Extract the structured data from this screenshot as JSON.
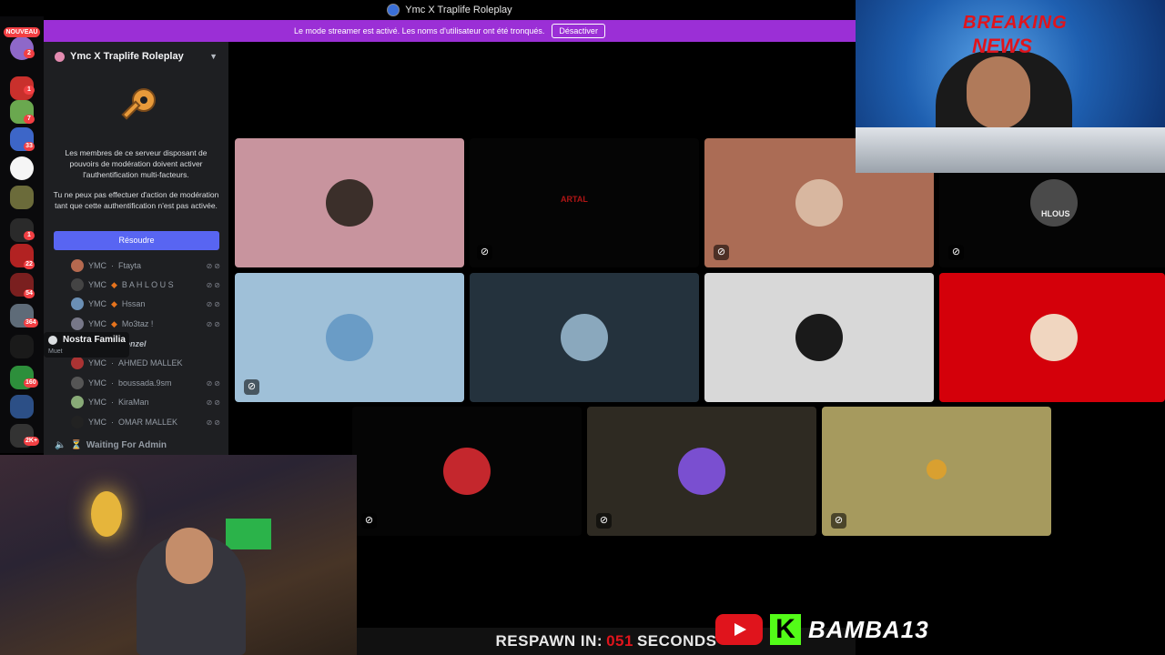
{
  "window": {
    "title": "Ymc X Traplife Roleplay"
  },
  "banner": {
    "message": "Le mode streamer est activé. Les noms d'utilisateur ont été tronqués.",
    "button": "Désactiver"
  },
  "rail": {
    "new_label": "NOUVEAU",
    "badges": [
      "2",
      "1",
      "7",
      "33",
      "1",
      "22",
      "54",
      "364",
      "160",
      "2K+"
    ]
  },
  "sidebar": {
    "server_name": "Ymc X Traplife Roleplay",
    "mfa_text_1": "Les membres de ce serveur disposant de pouvoirs de modération doivent activer l'authentification multi-facteurs.",
    "mfa_text_2": "Tu ne peux pas effectuer d'action de modération tant que cette authentification n'est pas activée.",
    "resolve_button": "Résoudre",
    "members": [
      {
        "prefix": "YMC",
        "sep": "·",
        "name": "Ftayta",
        "color": "#b5694f"
      },
      {
        "prefix": "YMC",
        "sep": "◆",
        "name": "B A H L O U S",
        "color": "#444"
      },
      {
        "prefix": "YMC",
        "sep": "◆",
        "name": "Hssan",
        "color": "#6b8fb5"
      },
      {
        "prefix": "YMC",
        "sep": "◆",
        "name": "Mo3taz !",
        "color": "#778"
      },
      {
        "prefix": "",
        "sep": "",
        "name": "enzel",
        "color": "#333"
      },
      {
        "prefix": "YMC",
        "sep": "·",
        "name": "AHMED MALLEK",
        "color": "#a33"
      },
      {
        "prefix": "YMC",
        "sep": "·",
        "name": "boussada.9sm",
        "color": "#555"
      },
      {
        "prefix": "YMC",
        "sep": "·",
        "name": "KiraMan",
        "color": "#8a7"
      },
      {
        "prefix": "YMC",
        "sep": "·",
        "name": "OMAR MALLEK",
        "color": "#222"
      }
    ],
    "channel": "Waiting For Admin",
    "tooltip_title": "Nostra Familia",
    "tooltip_sub": "Muet"
  },
  "tiles": [
    {
      "bg": "#c8949e",
      "avatar": "#3b2f2a"
    },
    {
      "bg": "#050505",
      "avatar": "",
      "label": "ARTAL"
    },
    {
      "bg": "#ab6c55",
      "avatar": "#d8b7a0"
    },
    {
      "bg": "#050505",
      "avatar": "#4a4a4a",
      "label": "HLOUS"
    },
    {
      "bg": "#9fc0d8",
      "avatar": "#6a9cc6"
    },
    {
      "bg": "#24323d",
      "avatar": "#8aa8bd"
    },
    {
      "bg": "#d8d8d8",
      "avatar": "#1a1a1a"
    },
    {
      "bg": "#d4000a",
      "avatar": "#f0d6c0"
    },
    {
      "bg": "#050505",
      "avatar": "#c4272d"
    },
    {
      "bg": "#2e2a22",
      "avatar": "#7a4fd0"
    },
    {
      "bg": "#a69a5e",
      "avatar": "#d9a030"
    }
  ],
  "overlay": {
    "breaking": "BREAKING",
    "news": "NEWS",
    "hud_left": "RESPAWN IN:",
    "hud_num": "051",
    "hud_right": "SECONDS",
    "brand_k": "K",
    "brand_name": "BAMBA13"
  }
}
